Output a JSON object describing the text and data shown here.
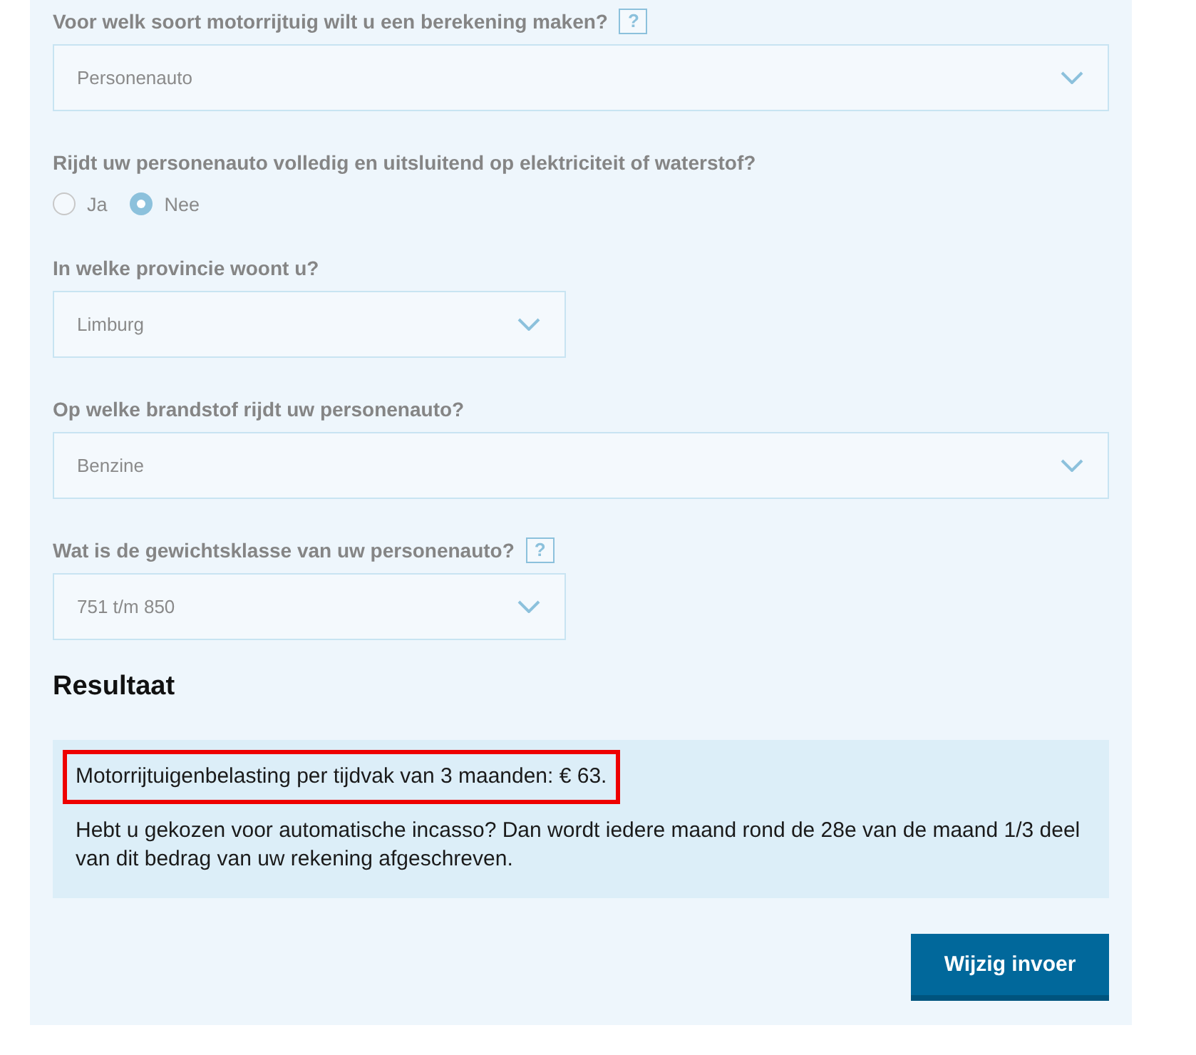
{
  "questions": [
    {
      "kind": "select",
      "label": "Voor welk soort motorrijtuig wilt u een berekening maken?",
      "help": "?",
      "value": "Personenauto"
    },
    {
      "kind": "radio",
      "label": "Rijdt uw personenauto volledig en uitsluitend op elektriciteit of waterstof?",
      "options": [
        {
          "label": "Ja",
          "selected": false
        },
        {
          "label": "Nee",
          "selected": true
        }
      ]
    },
    {
      "kind": "select",
      "label": "In welke provincie woont u?",
      "value": "Limburg"
    },
    {
      "kind": "select",
      "label": "Op welke brandstof rijdt uw personenauto?",
      "value": "Benzine"
    },
    {
      "kind": "select",
      "label": "Wat is de gewichtsklasse van uw personenauto?",
      "help": "?",
      "value": "751 t/m 850"
    }
  ],
  "result": {
    "heading": "Resultaat",
    "lines": [
      {
        "text": "Motorrijtuigenbelasting per tijdvak van 3 maanden: € 63.",
        "highlighted": true
      },
      {
        "text": "Hebt u gekozen voor automatische incasso? Dan wordt iedere maand rond de 28e van de maand 1/3 deel van dit bedrag van uw rekening afgeschreven.",
        "highlighted": false
      }
    ]
  },
  "button": "Wijzig invoer"
}
